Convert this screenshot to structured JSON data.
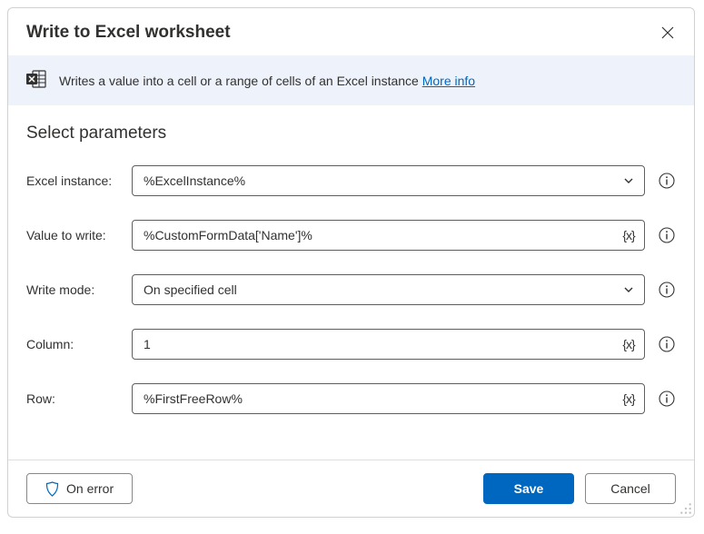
{
  "header": {
    "title": "Write to Excel worksheet"
  },
  "info": {
    "text": "Writes a value into a cell or a range of cells of an Excel instance ",
    "link_label": "More info"
  },
  "section": {
    "title": "Select parameters"
  },
  "fields": {
    "excel_instance": {
      "label": "Excel instance:",
      "value": "%ExcelInstance%"
    },
    "value_to_write": {
      "label": "Value to write:",
      "value": "%CustomFormData['Name']%"
    },
    "write_mode": {
      "label": "Write mode:",
      "value": "On specified cell"
    },
    "column": {
      "label": "Column:",
      "value": "1"
    },
    "row": {
      "label": "Row:",
      "value": "%FirstFreeRow%"
    }
  },
  "footer": {
    "on_error": "On error",
    "save": "Save",
    "cancel": "Cancel"
  },
  "icons": {
    "variable_token": "{x}"
  }
}
